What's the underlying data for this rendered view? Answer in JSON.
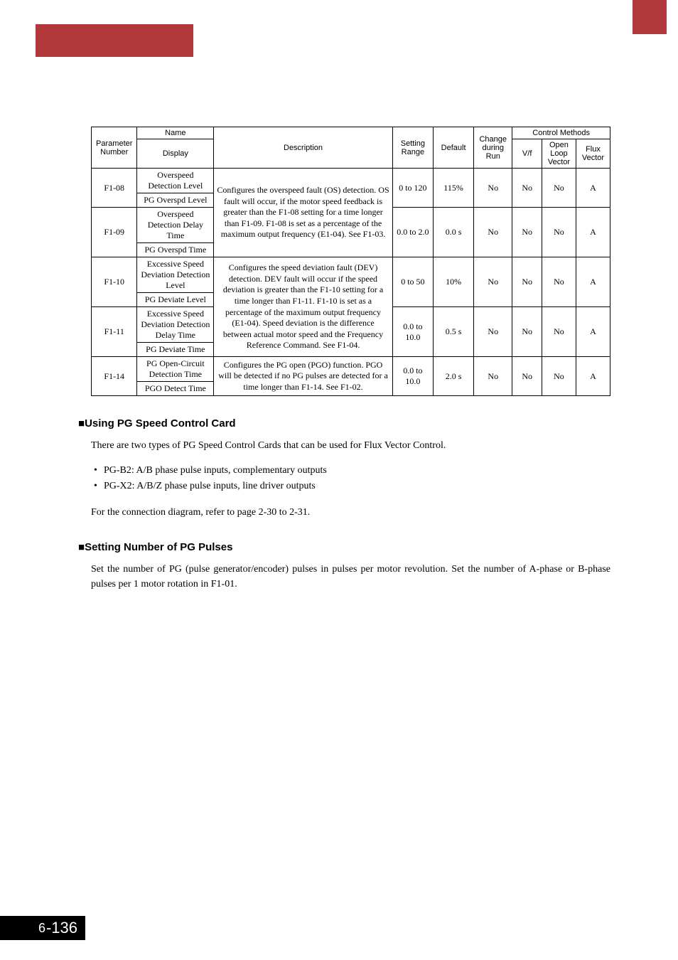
{
  "table": {
    "headers": {
      "param": "Parameter Number",
      "name": "Name",
      "display": "Display",
      "description": "Description",
      "setting": "Setting Range",
      "default": "Default",
      "change": "Change during Run",
      "methods": "Control Methods",
      "vf": "V/f",
      "olv": "Open Loop Vector",
      "flux": "Flux Vector"
    },
    "rows": [
      {
        "param": "F1-08",
        "name": "Overspeed Detection Level",
        "display": "PG Overspd Level",
        "desc": "Configures the overspeed fault (OS) detection.\nOS fault will occur, if the motor speed feedback is greater than the F1-08 setting for a time longer than F1-09. F1-08 is set as a percentage of the maximum output frequency (E1-04). See F1-03.",
        "setting": "0 to 120",
        "default": "115%",
        "change": "No",
        "vf": "No",
        "olv": "No",
        "flux": "A"
      },
      {
        "param": "F1-09",
        "name": "Overspeed Detection Delay Time",
        "display": "PG Overspd Time",
        "setting": "0.0 to 2.0",
        "default": "0.0 s",
        "change": "No",
        "vf": "No",
        "olv": "No",
        "flux": "A"
      },
      {
        "param": "F1-10",
        "name": "Excessive Speed Deviation Detection Level",
        "display": "PG Deviate Level",
        "desc": "Configures the speed deviation fault (DEV) detection.\nDEV fault will occur if the speed deviation is greater than the F1-10 setting for a time longer than F1-11. F1-10 is set as a percentage of the maximum output frequency (E1-04).\nSpeed deviation is the difference between actual motor speed and the Frequency Reference Command. See F1-04.",
        "setting": "0 to 50",
        "default": "10%",
        "change": "No",
        "vf": "No",
        "olv": "No",
        "flux": "A"
      },
      {
        "param": "F1-11",
        "name": "Excessive Speed Deviation Detection Delay Time",
        "display": "PG Deviate Time",
        "setting": "0.0 to 10.0",
        "default": "0.5 s",
        "change": "No",
        "vf": "No",
        "olv": "No",
        "flux": "A"
      },
      {
        "param": "F1-14",
        "name": "PG Open-Circuit Detection Time",
        "display": "PGO Detect Time",
        "desc": "Configures the PG open (PGO) function. PGO will be detected if no PG pulses are detected for a time longer than F1-14. See F1-02.",
        "setting": "0.0 to 10.0",
        "default": "2.0 s",
        "change": "No",
        "vf": "No",
        "olv": "No",
        "flux": "A"
      }
    ]
  },
  "sections": {
    "s1": {
      "title": "Using PG Speed Control Card",
      "p1": "There are two types of PG Speed Control Cards that can be used for Flux Vector Control.",
      "li1": "PG-B2: A/B phase pulse inputs, complementary outputs",
      "li2": "PG-X2: A/B/Z phase pulse inputs, line driver outputs",
      "p2": "For the connection diagram, refer to page 2-30 to 2-31."
    },
    "s2": {
      "title": "Setting Number of PG Pulses",
      "p1": "Set the number of PG (pulse generator/encoder) pulses in pulses per motor revolution. Set the number of A-phase or B-phase pulses per 1 motor rotation in F1-01."
    }
  },
  "footer": {
    "chapter": "6",
    "page": "136"
  }
}
